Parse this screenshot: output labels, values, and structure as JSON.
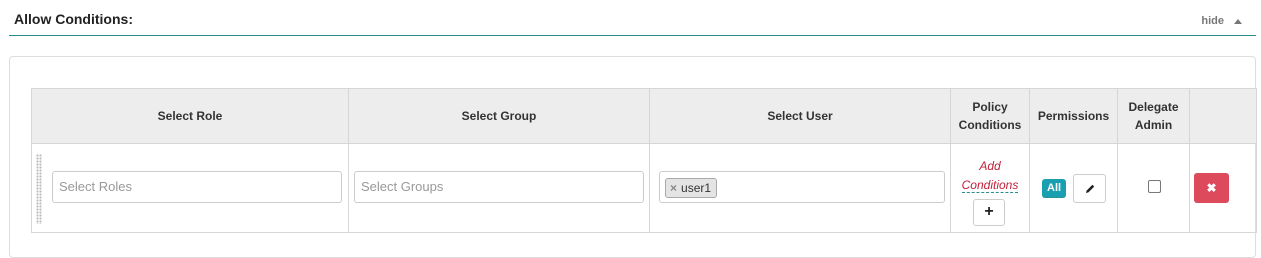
{
  "section": {
    "title": "Allow Conditions:",
    "toggle_label": "hide"
  },
  "table": {
    "headers": {
      "role": "Select Role",
      "group": "Select Group",
      "user": "Select User",
      "policy_line1": "Policy",
      "policy_line2": "Conditions",
      "permissions": "Permissions",
      "delegate_line1": "Delegate",
      "delegate_line2": "Admin"
    },
    "row": {
      "roles_placeholder": "Select Roles",
      "groups_placeholder": "Select Groups",
      "users": [
        {
          "name": "user1"
        }
      ],
      "add_conditions_line1": "Add",
      "add_conditions_line2": "Conditions",
      "add_button_icon": "plus-icon",
      "permission_badge": "All",
      "edit_icon": "pencil-icon",
      "delegate_admin_checked": false,
      "delete_icon": "times-icon"
    }
  },
  "colors": {
    "accent": "#2c8c8c",
    "badge": "#1a9fb0",
    "danger": "#dc4a5c",
    "link": "#c0223a",
    "header_bg": "#ededed"
  }
}
